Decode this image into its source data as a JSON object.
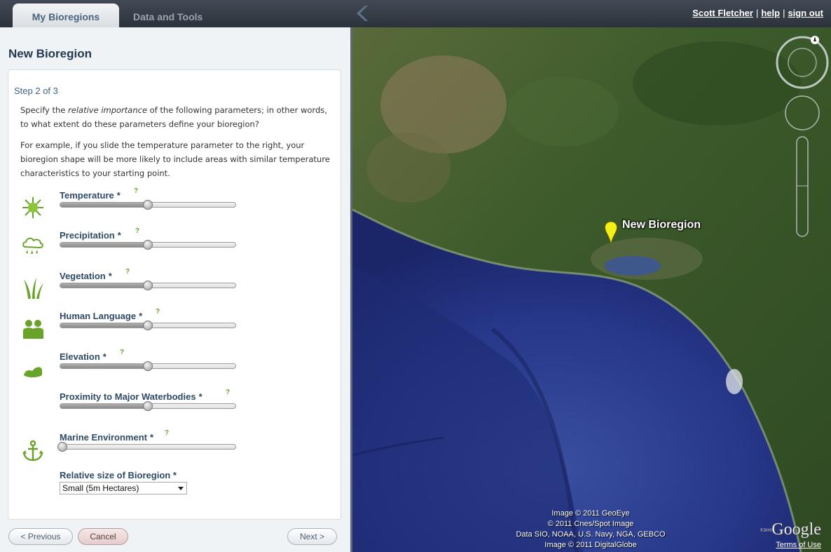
{
  "tabs": [
    {
      "label": "My Bioregions",
      "active": true
    },
    {
      "label": "Data and Tools",
      "active": false
    }
  ],
  "user": {
    "name": "Scott Fletcher",
    "help": "help",
    "signout": "sign out",
    "separator": "|"
  },
  "panel": {
    "title": "New Bioregion",
    "step": "Step 2 of 3",
    "intro_pre": "Specify the ",
    "intro_em": "relative importance",
    "intro_post": " of the following parameters; in other words, to what extent do these parameters define your bioregion?",
    "example": "For example, if you slide the temperature parameter to the right, your bioregion shape will be more likely to include areas with similar temperature characteristics to your starting point.",
    "required_mark": "*",
    "help_mark": "?",
    "params": [
      {
        "label": "Temperature",
        "icon": "sun-icon",
        "value": 0.5
      },
      {
        "label": "Precipitation",
        "icon": "rain-cloud-icon",
        "value": 0.5
      },
      {
        "label": "Vegetation",
        "icon": "grass-icon",
        "value": 0.5
      },
      {
        "label": "Human Language",
        "icon": "people-icon",
        "value": 0.5
      },
      {
        "label": "Elevation",
        "icon": "terrain-icon",
        "value": 0.5
      },
      {
        "label": "Proximity to Major Waterbodies",
        "icon": "",
        "value": 0.5
      },
      {
        "label": "Marine Environment",
        "icon": "anchor-icon",
        "value": 0.0
      }
    ],
    "size_label": "Relative size of Bioregion",
    "size_value": "Small (5m Hectares)",
    "buttons": {
      "previous": "< Previous",
      "cancel": "Cancel",
      "next": "Next >"
    }
  },
  "map": {
    "marker_label": "New Bioregion",
    "attribution": [
      "Image © 2011 GeoEye",
      "© 2011 Cnes/Spot Image",
      "Data SIO, NOAA, U.S. Navy, NGA, GEBCO",
      "Image © 2011 DigitalGlobe"
    ],
    "logo": "Google",
    "logo_year": "©2010",
    "terms": "Terms of Use"
  },
  "colors": {
    "accent": "#2e4a66",
    "help": "#6aa32a",
    "ocean": "#2c3f8c",
    "land": "#3f5a2a"
  }
}
